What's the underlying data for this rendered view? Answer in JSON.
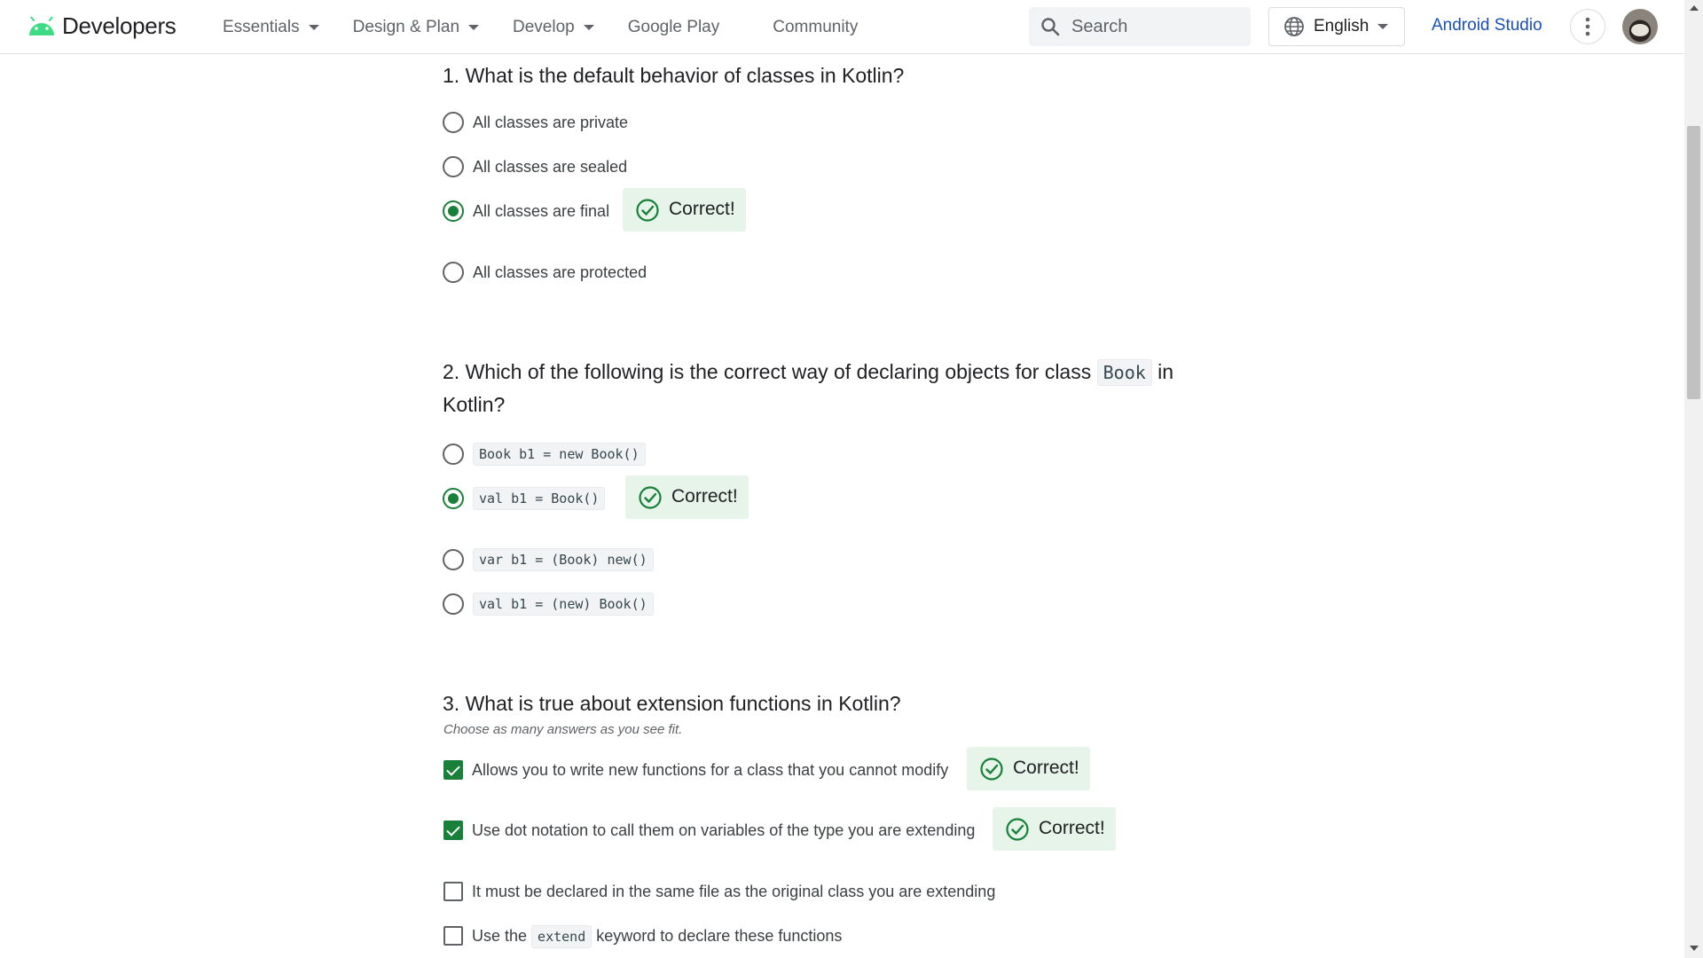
{
  "header": {
    "logo_text": "Developers",
    "nav": [
      "Essentials",
      "Design & Plan",
      "Develop",
      "Google Play",
      "Community"
    ],
    "search_placeholder": "Search",
    "language": "English",
    "studio_link": "Android Studio"
  },
  "colors": {
    "correct": "#188038",
    "feedback_bg": "#e6f4ea",
    "link": "#1a4fb8"
  },
  "quiz": {
    "feedback_label": "Correct!",
    "q1": {
      "text": "1. What is the default behavior of classes in Kotlin?",
      "options": [
        "All classes are private",
        "All classes are sealed",
        "All classes are final",
        "All classes are protected"
      ],
      "selected": 2
    },
    "q2": {
      "text_before": "2. Which of the following is the correct way of declaring objects for class ",
      "text_code": "Book",
      "text_after": " in Kotlin?",
      "options": [
        "Book b1 = new Book()",
        "val b1 = Book()",
        "var b1 = (Book) new()",
        "val b1 = (new) Book()"
      ],
      "selected": 1
    },
    "q3": {
      "text": "3. What is true about extension functions in Kotlin?",
      "hint": "Choose as many answers as you see fit.",
      "options": [
        "Allows you to write new functions for a class that you cannot modify",
        "Use dot notation to call them on variables of the type you are extending",
        "It must be declared in the same file as the original class you are extending"
      ],
      "option4_before": "Use the ",
      "option4_code": "extend",
      "option4_after": " keyword to declare these functions",
      "checked": [
        0,
        1
      ]
    }
  }
}
